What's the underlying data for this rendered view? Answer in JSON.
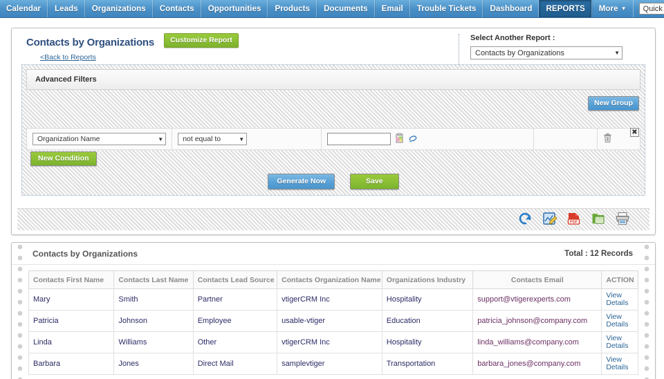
{
  "topnav": {
    "tabs": [
      {
        "label": "Calendar",
        "active": false,
        "caret": false
      },
      {
        "label": "Leads",
        "active": false,
        "caret": false
      },
      {
        "label": "Organizations",
        "active": false,
        "caret": false
      },
      {
        "label": "Contacts",
        "active": false,
        "caret": false
      },
      {
        "label": "Opportunities",
        "active": false,
        "caret": false
      },
      {
        "label": "Products",
        "active": false,
        "caret": false
      },
      {
        "label": "Documents",
        "active": false,
        "caret": false
      },
      {
        "label": "Email",
        "active": false,
        "caret": false
      },
      {
        "label": "Trouble Tickets",
        "active": false,
        "caret": false
      },
      {
        "label": "Dashboard",
        "active": false,
        "caret": false
      },
      {
        "label": "REPORTS",
        "active": true,
        "caret": false
      },
      {
        "label": "More",
        "active": false,
        "caret": true
      }
    ],
    "quick_create": {
      "value": "Quick Create...",
      "caret_icon": "chevron-down-icon"
    },
    "accent_active": "#1f5c8d",
    "accent_bar": "#4b91c8"
  },
  "report": {
    "title": "Contacts by Organizations",
    "customize_label": "Customize Report",
    "back_link": "<Back to Reports",
    "select_another_label": "Select Another Report :",
    "selected_report": "Contacts by Organizations",
    "select_caret_icon": "chevron-down-icon"
  },
  "filters": {
    "section_label": "Advanced Filters",
    "new_group_label": "New Group",
    "group_close_icon": "close-icon",
    "condition": {
      "field": "Organization Name",
      "operator": "not equal to",
      "value": "",
      "value_placeholder": "",
      "picker_icon": "select-record-icon",
      "clear_icon": "eraser-icon",
      "delete_icon": "trash-icon"
    },
    "new_condition_label": "New Condition",
    "generate_label": "Generate Now",
    "save_label": "Save"
  },
  "export_bar": {
    "icons": [
      {
        "name": "refresh-icon",
        "title": "Refresh"
      },
      {
        "name": "edit-report-icon",
        "title": "Edit"
      },
      {
        "name": "export-pdf-icon",
        "title": "PDF",
        "label": "PDF"
      },
      {
        "name": "export-excel-icon",
        "title": "Excel",
        "label": "XLS"
      },
      {
        "name": "print-icon",
        "title": "Print"
      }
    ]
  },
  "results": {
    "title": "Contacts by Organizations",
    "total": "Total : 12 Records",
    "columns": [
      "Contacts First Name",
      "Contacts Last Name",
      "Contacts Lead Source",
      "Contacts Organization Name",
      "Organizations Industry",
      "Contacts Email",
      "ACTION"
    ],
    "action_label": "View Details",
    "rows": [
      {
        "first_name": "Mary",
        "last_name": "Smith",
        "lead_source": "Partner",
        "organization": "vtigerCRM Inc",
        "industry": "Hospitality",
        "email": "support@vtigerexperts.com"
      },
      {
        "first_name": "Patricia",
        "last_name": "Johnson",
        "lead_source": "Employee",
        "organization": "usable-vtiger",
        "industry": "Education",
        "email": "patricia_johnson@company.com"
      },
      {
        "first_name": "Linda",
        "last_name": "Williams",
        "lead_source": "Other",
        "organization": "vtigerCRM Inc",
        "industry": "Hospitality",
        "email": "linda_williams@company.com"
      },
      {
        "first_name": "Barbara",
        "last_name": "Jones",
        "lead_source": "Direct Mail",
        "organization": "samplevtiger",
        "industry": "Transportation",
        "email": "barbara_jones@company.com"
      }
    ]
  }
}
